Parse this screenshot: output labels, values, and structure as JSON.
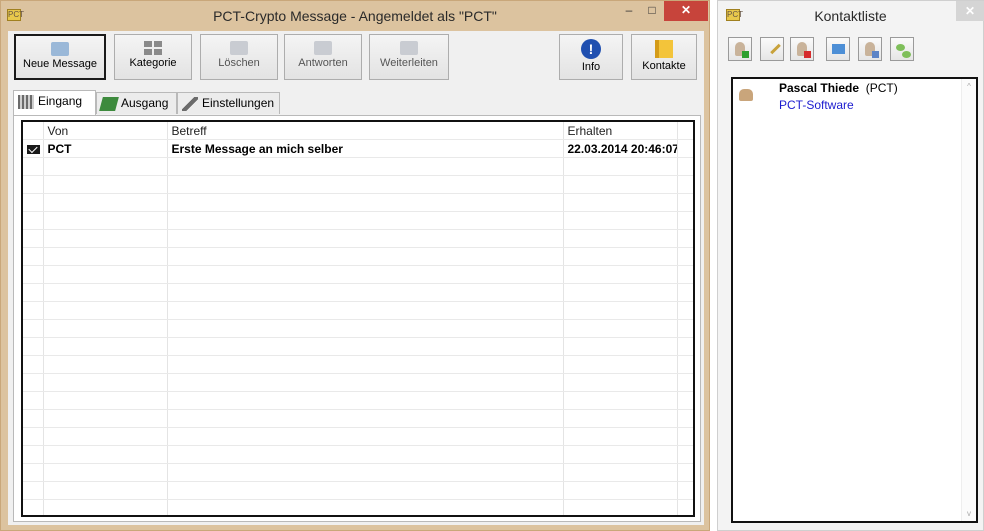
{
  "main_window": {
    "title": "PCT-Crypto Message - Angemeldet als \"PCT\"",
    "icon_text": "PCT",
    "controls": {
      "minimize": "–",
      "maximize": "□",
      "close": "✕"
    }
  },
  "toolbar": {
    "new_message": "Neue Message",
    "category": "Kategorie",
    "delete": "Löschen",
    "reply": "Antworten",
    "forward": "Weiterleiten",
    "info": "Info",
    "contacts": "Kontakte",
    "info_glyph": "!"
  },
  "tabs": {
    "inbox": "Eingang",
    "outbox": "Ausgang",
    "settings": "Einstellungen"
  },
  "inbox": {
    "columns": [
      "Von",
      "Betreff",
      "Erhalten"
    ],
    "rows": [
      {
        "from": "PCT",
        "subject": "Erste Message an mich selber",
        "received": "22.03.2014 20:46:07",
        "icon": "envelope-icon"
      }
    ]
  },
  "contacts_window": {
    "title": "Kontaktliste",
    "close": "✕",
    "icon_text": "PCT",
    "contacts": [
      {
        "name": "Pascal Thiede",
        "alias": "(PCT)",
        "org": "PCT-Software"
      }
    ],
    "scroll_up": "^",
    "scroll_down": "v"
  }
}
